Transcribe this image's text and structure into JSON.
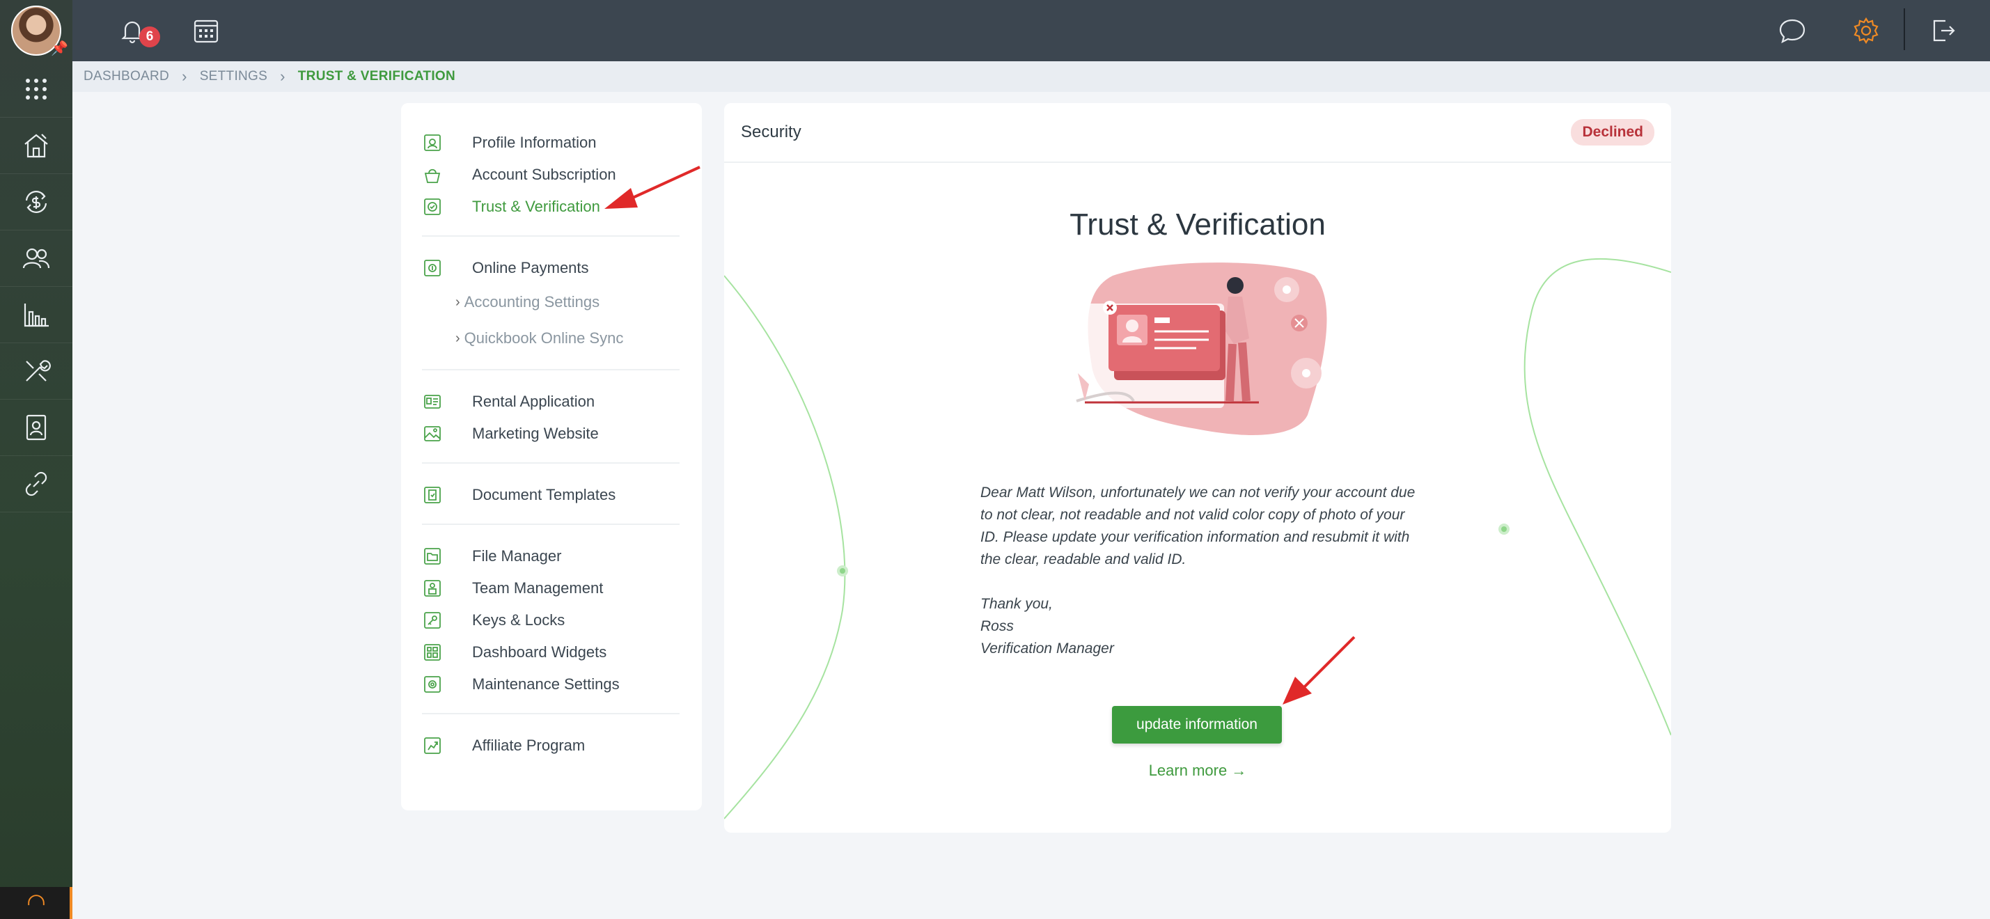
{
  "topbar": {
    "notification_count": "6"
  },
  "breadcrumb": [
    "DASHBOARD",
    "SETTINGS",
    "TRUST & VERIFICATION"
  ],
  "menu": {
    "group1": [
      "Profile Information",
      "Account Subscription",
      "Trust & Verification"
    ],
    "group2": {
      "main": "Online Payments",
      "subs": [
        "Accounting Settings",
        "Quickbook Online Sync"
      ]
    },
    "group3": [
      "Rental Application",
      "Marketing Website"
    ],
    "group4": [
      "Document Templates"
    ],
    "group5": [
      "File Manager",
      "Team Management",
      "Keys & Locks",
      "Dashboard Widgets",
      "Maintenance Settings"
    ],
    "group6": [
      "Affiliate Program"
    ]
  },
  "security": {
    "title": "Security",
    "status": "Declined",
    "heading": "Trust & Verification",
    "message": "Dear Matt Wilson, unfortunately we can not verify your account due to not clear, not readable and not valid color copy of photo of your ID. Please update your verification information and resubmit it with the clear, readable and valid ID.",
    "thanks": "Thank you,",
    "signer": "Ross",
    "signer_title": "Verification Manager",
    "button": "update information",
    "learn_more": "Learn more →"
  },
  "colors": {
    "accent": "#3f9a3e",
    "declined": "#b8323a",
    "topbar": "#3c4650"
  }
}
